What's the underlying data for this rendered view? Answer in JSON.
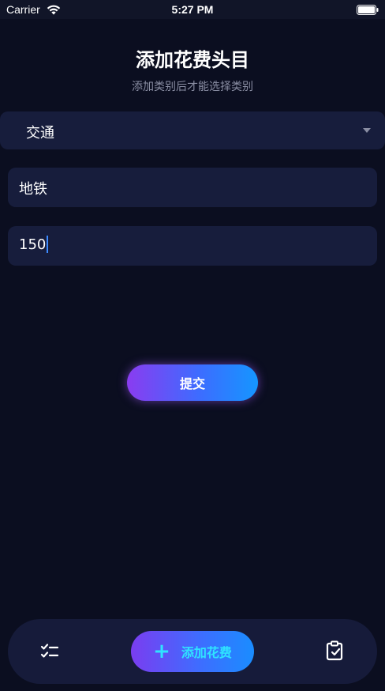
{
  "status_bar": {
    "carrier": "Carrier",
    "time": "5:27 PM"
  },
  "header": {
    "title": "添加花费头目",
    "subtitle": "添加类别后才能选择类别"
  },
  "form": {
    "category_value": "交通",
    "name_value": "地铁",
    "amount_value": "150"
  },
  "submit_label": "提交",
  "tab_bar": {
    "add_label": "添加花费"
  },
  "colors": {
    "background": "#0b0e20",
    "field": "#171d3c",
    "accent_purple": "#8a3cf0",
    "accent_blue": "#1596ff",
    "accent_cyan": "#2fe3ff"
  },
  "icons": [
    "wifi-icon",
    "battery-icon",
    "dropdown-arrow-icon",
    "checklist-icon",
    "plus-icon",
    "clipboard-check-icon"
  ]
}
